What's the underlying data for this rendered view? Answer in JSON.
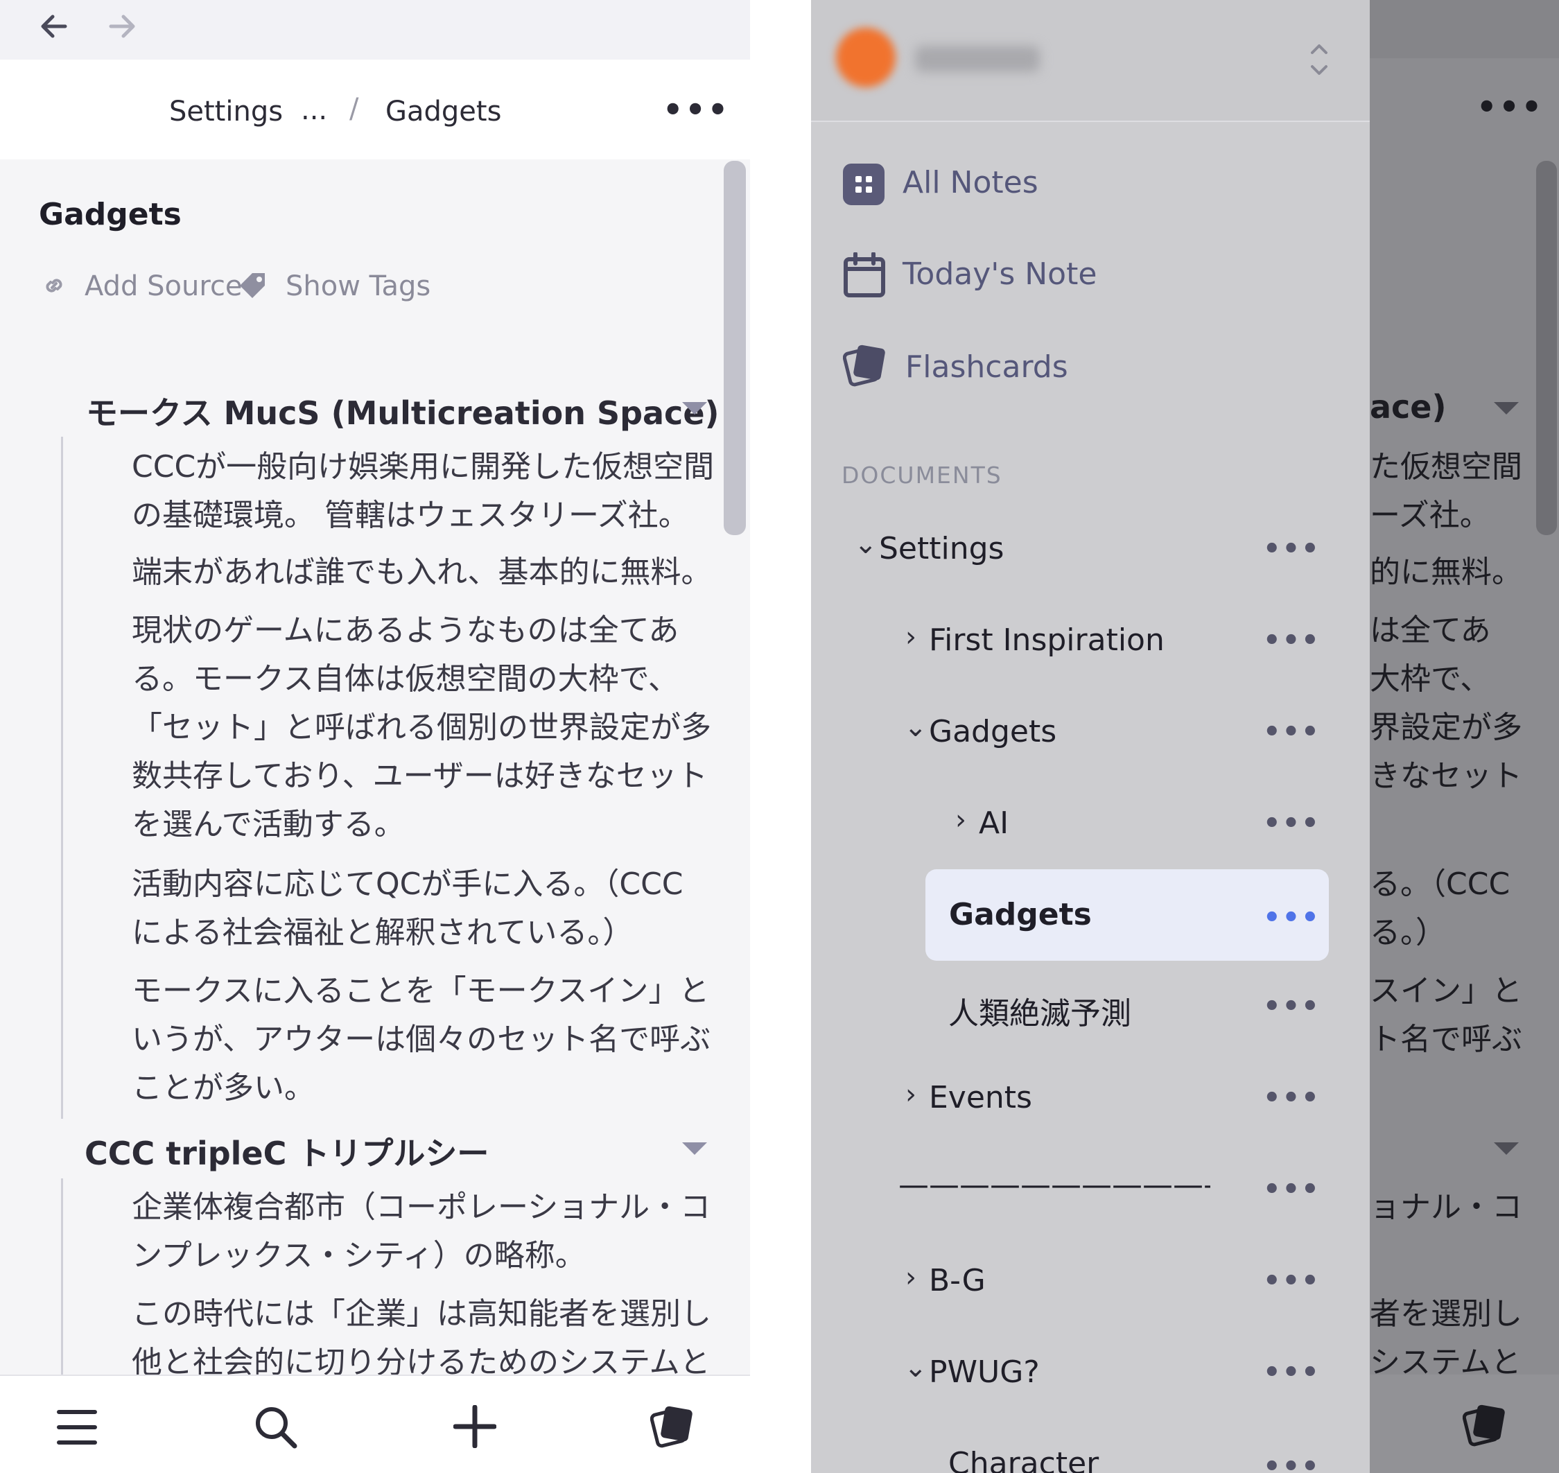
{
  "left": {
    "nav": {
      "back_icon": "arrow-left-icon",
      "forward_icon": "arrow-right-icon"
    },
    "breadcrumb": {
      "root": "Settings",
      "ellipsis": "...",
      "separator": "/",
      "current": "Gadgets"
    },
    "more": "•••",
    "page_title": "Gadgets",
    "meta": {
      "add_source": "Add Source",
      "show_tags": "Show Tags"
    },
    "blocks": [
      {
        "heading": "モークス MucS (Multicreation Space)",
        "lines": [
          "CCCが一般向け娯楽用に開発した仮想空間",
          "の基礎環境。 管轄はウェスタリーズ社。",
          "端末があれば誰でも入れ、基本的に無料。",
          "現状のゲームにあるようなものは全てあ",
          "る。モークス自体は仮想空間の大枠で、",
          "「セット」と呼ばれる個別の世界設定が多",
          "数共存しており、ユーザーは好きなセット",
          "を選んで活動する。",
          "活動内容に応じてQCが手に入る。（CCC",
          "による社会福祉と解釈されている。）",
          "モークスに入ることを「モークスイン」と",
          "いうが、アウターは個々のセット名で呼ぶ",
          "ことが多い。"
        ]
      },
      {
        "heading": "CCC tripleC トリプルシー",
        "lines": [
          "企業体複合都市（コーポレーショナル・コ",
          "ンプレックス・シティ）の略称。",
          "この時代には「企業」は高知能者を選別し",
          "他と社会的に切り分けるためのシステムと"
        ]
      }
    ],
    "bottom_icons": [
      "menu-icon",
      "search-icon",
      "plus-icon",
      "flashcards-icon"
    ]
  },
  "right": {
    "more": "•••",
    "background_fragments": [
      "ace)",
      "た仮想空間",
      "ーズ社。",
      "的に無料。",
      "は全てあ",
      "大枠で、",
      "界設定が多",
      "きなセット",
      "る。（CCC",
      "る。）",
      "スイン」と",
      "ト名で呼ぶ",
      "ョナル・コ",
      "者を選別し",
      "システムと"
    ],
    "drawer": {
      "nav": [
        {
          "label": "All Notes",
          "icon": "grid-icon"
        },
        {
          "label": "Today's Note",
          "icon": "calendar-icon"
        },
        {
          "label": "Flashcards",
          "icon": "flashcards-icon"
        }
      ],
      "section_title": "DOCUMENTS",
      "tree": [
        {
          "label": "Settings",
          "chevron": "⌄",
          "level": 0
        },
        {
          "label": "First Inspiration",
          "chevron": "›",
          "level": 1
        },
        {
          "label": "Gadgets",
          "chevron": "⌄",
          "level": 1
        },
        {
          "label": "AI",
          "chevron": "›",
          "level": 2
        },
        {
          "label": "Gadgets",
          "chevron": "",
          "level": 2,
          "selected": true
        },
        {
          "label": "人類絶滅予測",
          "chevron": "",
          "level": 2
        },
        {
          "label": "Events",
          "chevron": "›",
          "level": 1
        },
        {
          "label": "———————————…",
          "chevron": "",
          "level": 1
        },
        {
          "label": "B-G",
          "chevron": "›",
          "level": 1
        },
        {
          "label": "PWUG?",
          "chevron": "⌄",
          "level": 1
        },
        {
          "label": "Character",
          "chevron": "",
          "level": 2
        }
      ],
      "item_more": "•••"
    }
  }
}
